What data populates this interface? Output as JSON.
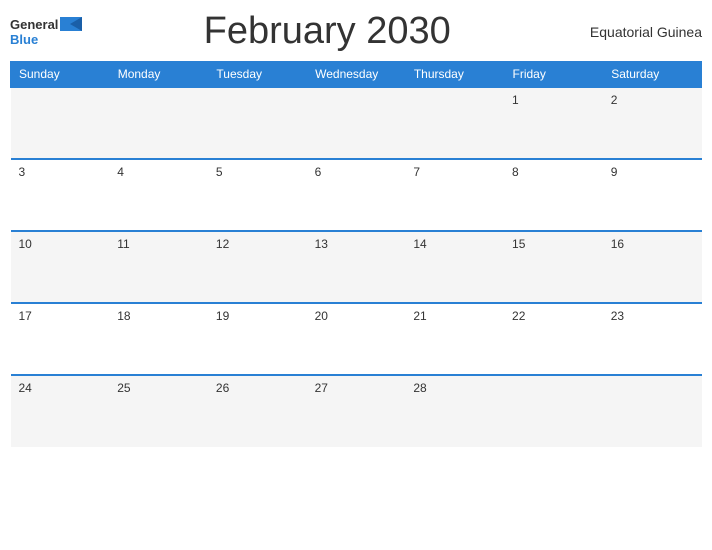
{
  "header": {
    "title": "February 2030",
    "country": "Equatorial Guinea",
    "logo": {
      "general": "General",
      "blue": "Blue"
    }
  },
  "calendar": {
    "days_of_week": [
      "Sunday",
      "Monday",
      "Tuesday",
      "Wednesday",
      "Thursday",
      "Friday",
      "Saturday"
    ],
    "weeks": [
      [
        "",
        "",
        "",
        "",
        "",
        "1",
        "2"
      ],
      [
        "3",
        "4",
        "5",
        "6",
        "7",
        "8",
        "9"
      ],
      [
        "10",
        "11",
        "12",
        "13",
        "14",
        "15",
        "16"
      ],
      [
        "17",
        "18",
        "19",
        "20",
        "21",
        "22",
        "23"
      ],
      [
        "24",
        "25",
        "26",
        "27",
        "28",
        "",
        ""
      ]
    ]
  },
  "colors": {
    "header_bg": "#2980d4",
    "header_text": "#ffffff",
    "accent": "#2980d4",
    "row_odd": "#f5f5f5",
    "row_even": "#ffffff"
  }
}
